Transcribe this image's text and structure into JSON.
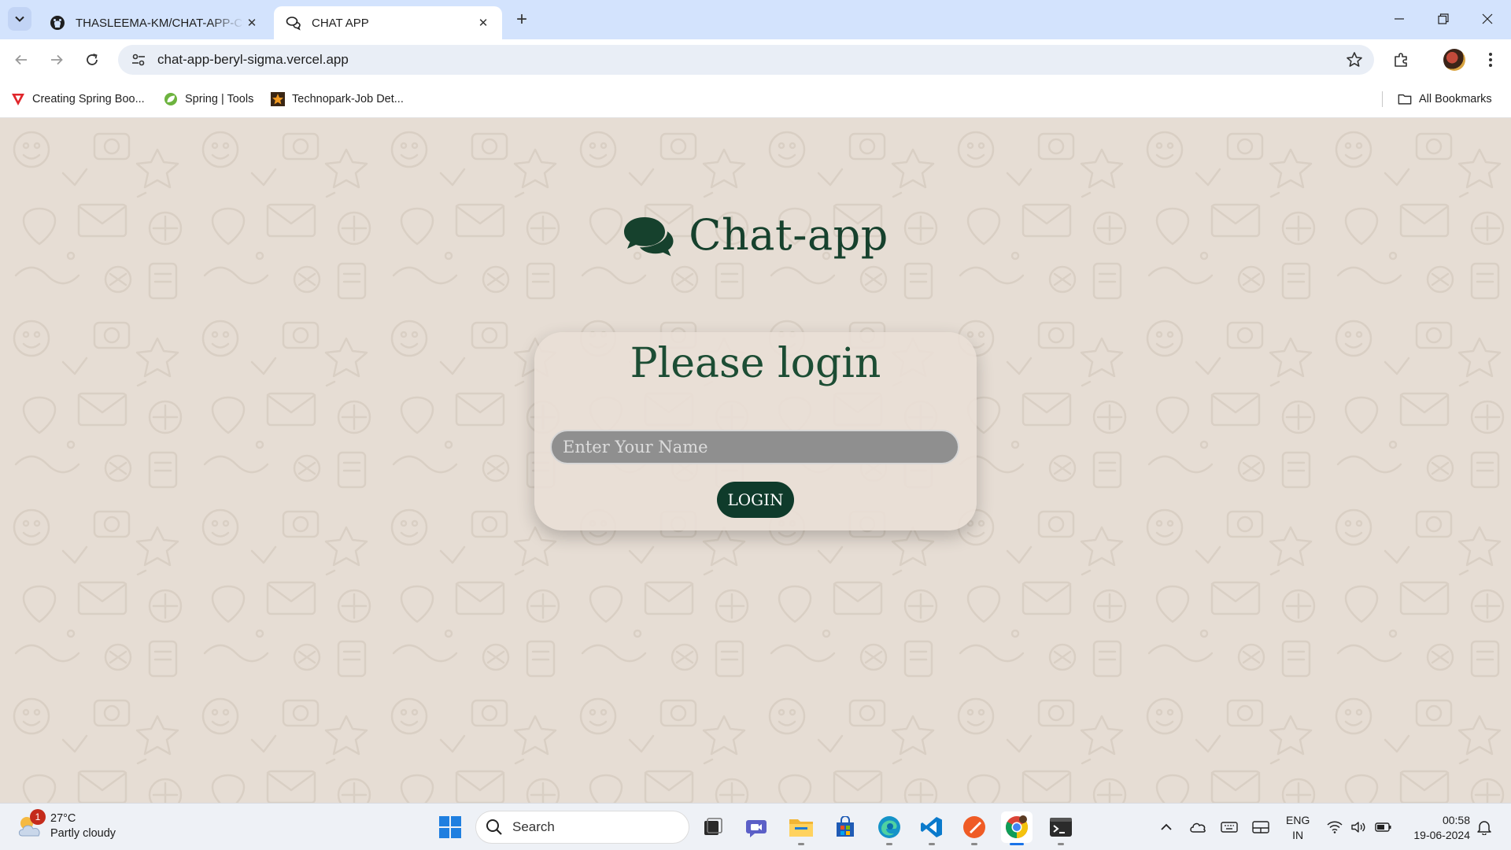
{
  "browser": {
    "tabs": [
      {
        "title": "THASLEEMA-KM/CHAT-APP-CLIENT",
        "icon": "github-icon",
        "active": false
      },
      {
        "title": "CHAT APP",
        "icon": "chat-bubbles-icon",
        "active": true
      }
    ],
    "url": "chat-app-beryl-sigma.vercel.app",
    "bookmarks": [
      {
        "label": "Creating Spring Boo...",
        "icon": "red-v-icon"
      },
      {
        "label": "Spring | Tools",
        "icon": "spring-leaf-icon"
      },
      {
        "label": "Technopark-Job Det...",
        "icon": "technopark-star-icon"
      }
    ],
    "all_bookmarks": "All Bookmarks"
  },
  "app": {
    "brand": "Chat-app",
    "login_heading": "Please login",
    "name_placeholder": "Enter Your Name",
    "name_value": "",
    "login_button": "LOGIN",
    "colors": {
      "accent": "#16412d",
      "button": "#0f3b2b",
      "background": "#e6ddd4"
    }
  },
  "taskbar": {
    "weather_temp": "27°C",
    "weather_desc": "Partly cloudy",
    "weather_badge": "1",
    "search_label": "Search",
    "lang_line1": "ENG",
    "lang_line2": "IN",
    "time": "00:58",
    "date": "19-06-2024"
  }
}
